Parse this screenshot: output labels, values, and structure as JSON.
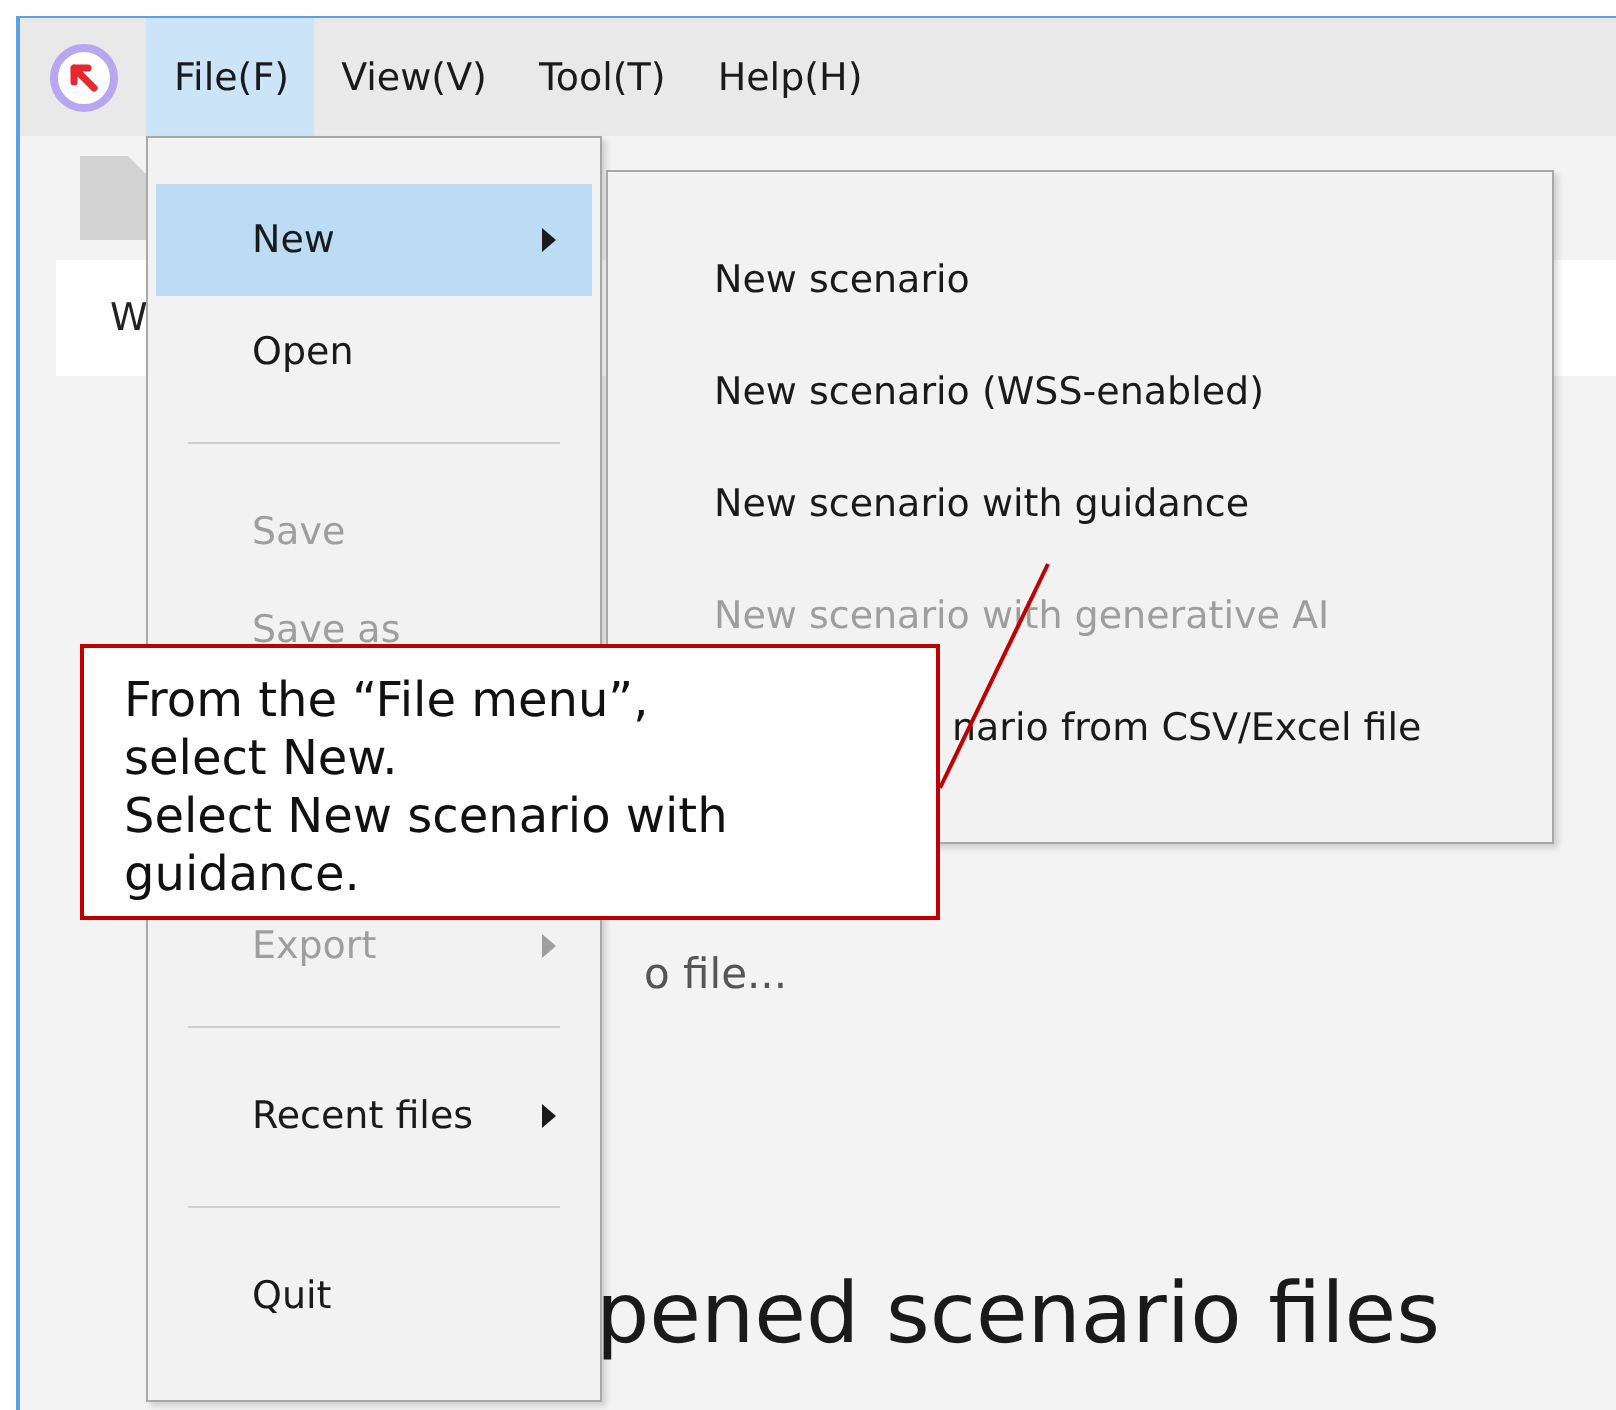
{
  "menubar": {
    "items": [
      {
        "label": "File(F)",
        "selected": true
      },
      {
        "label": "View(V)",
        "selected": false
      },
      {
        "label": "Tool(T)",
        "selected": false
      },
      {
        "label": "Help(H)",
        "selected": false
      }
    ]
  },
  "background": {
    "tab_label": "W",
    "link_text": "o file...",
    "heading": "pened scenario files"
  },
  "file_menu": {
    "items": [
      {
        "kind": "item",
        "label": "New",
        "selected": true,
        "disabled": false,
        "has_submenu": true
      },
      {
        "kind": "item",
        "label": "Open",
        "selected": false,
        "disabled": false,
        "has_submenu": false
      },
      {
        "kind": "separator"
      },
      {
        "kind": "item",
        "label": "Save",
        "selected": false,
        "disabled": true,
        "has_submenu": false
      },
      {
        "kind": "item",
        "label": "Save as",
        "selected": false,
        "disabled": true,
        "has_submenu": false
      },
      {
        "kind": "item",
        "label": "Export",
        "selected": false,
        "disabled": true,
        "has_submenu": true
      },
      {
        "kind": "separator"
      },
      {
        "kind": "item",
        "label": "Recent files",
        "selected": false,
        "disabled": false,
        "has_submenu": true
      },
      {
        "kind": "separator"
      },
      {
        "kind": "item",
        "label": "Quit",
        "selected": false,
        "disabled": false,
        "has_submenu": false
      }
    ]
  },
  "submenu": {
    "items": [
      {
        "kind": "item",
        "label": "New scenario",
        "disabled": false
      },
      {
        "kind": "item",
        "label": "New scenario (WSS-enabled)",
        "disabled": false
      },
      {
        "kind": "item",
        "label": "New scenario with guidance",
        "disabled": false
      },
      {
        "kind": "item",
        "label": "New scenario with generative AI",
        "disabled": true
      },
      {
        "kind": "covered",
        "label": "nario from CSV/Excel file",
        "disabled": false
      }
    ]
  },
  "callout": {
    "texts": [
      "From the “File menu”, select New.",
      "Select New scenario with guidance."
    ]
  }
}
